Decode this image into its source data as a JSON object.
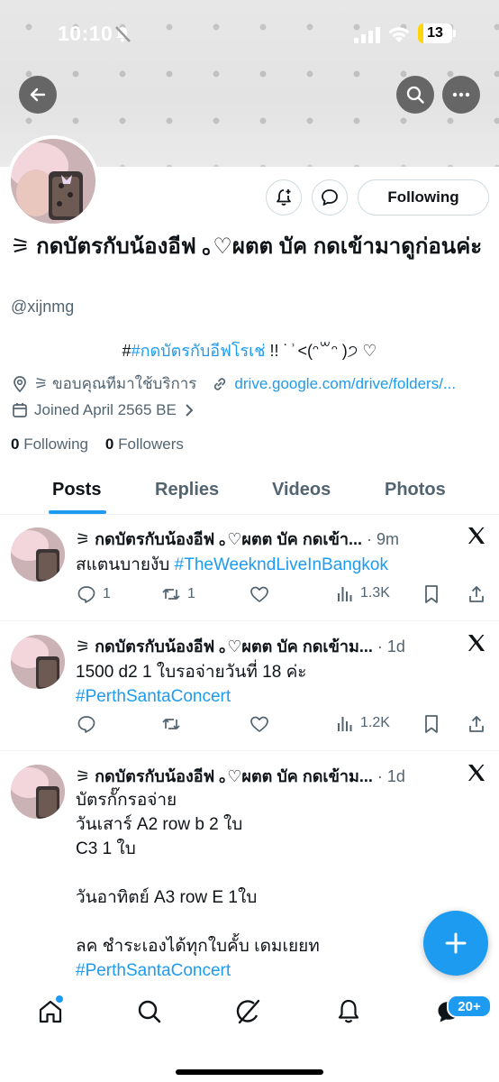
{
  "status_bar": {
    "time": "10:10",
    "battery": "13"
  },
  "profile": {
    "display_name": "⚞ กดบัตรกับน้องอีฟ ｡♡ผตต บัค กดเข้ามาดูก่อนค่ะ",
    "handle": "@xijnmg",
    "bio_hash": "#",
    "bio_hashtag": "#กดบัตรกับอีฟโรเช่",
    "bio_rest": " !!   ˙ ͗ ˂(ᵔ꒳ᵔ )੭ ♡",
    "location": "⚞ ขอบคุณทีมาใช้บริการ",
    "link": "drive.google.com/drive/folders/...",
    "joined": "Joined April 2565 BE",
    "following_count": "0",
    "following_label": "Following",
    "followers_count": "0",
    "followers_label": "Followers",
    "following_button": "Following"
  },
  "tabs": [
    "Posts",
    "Replies",
    "Videos",
    "Photos"
  ],
  "posts": [
    {
      "name": "⚞ กดบัตรกับน้องอีฟ ｡♡ผตต บัค กดเข้า...",
      "time": "· 9m",
      "text": "สแตนบายงับ ",
      "hashtag": "#TheWeekndLiveInBangkok",
      "replies": "1",
      "reposts": "1",
      "views": "1.3K"
    },
    {
      "name": "⚞ กดบัตรกับน้องอีฟ ｡♡ผตต บัค กดเข้าม...",
      "time": "· 1d",
      "text": "1500 d2 1 ใบรอจ่ายวันที่ 18 ค่ะ",
      "hashtag": "#PerthSantaConcert",
      "replies": "",
      "reposts": "",
      "views": "1.2K"
    },
    {
      "name": "⚞ กดบัตรกับน้องอีฟ ｡♡ผตต บัค กดเข้าม...",
      "time": "· 1d",
      "text": "บัตรกั๊กรอจ่าย\nวันเสาร์ A2 row b 2 ใบ\nC3 1 ใบ\n\nวันอาทิตย์ A3 row E 1ใบ\n\nลค ชำระเองได้ทุกใบคั้บ เดมเยยท",
      "hashtag": "#PerthSantaConcert"
    }
  ],
  "bottom_nav": {
    "messages_badge": "20+"
  },
  "colors": {
    "accent": "#1d9bf0",
    "secondary_text": "#536471"
  }
}
